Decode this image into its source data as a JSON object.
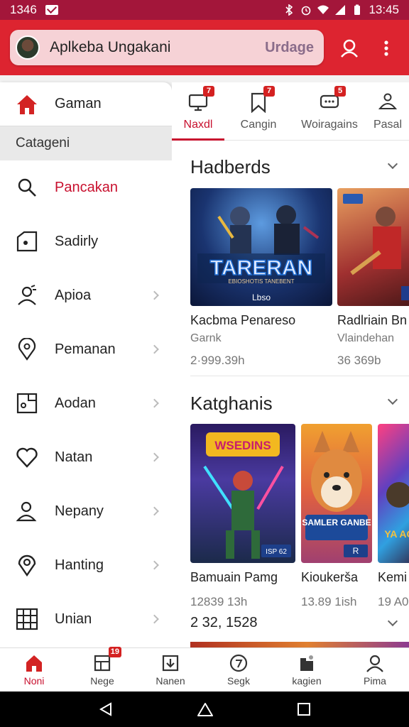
{
  "status": {
    "time_left": "1346",
    "time_right": "13:45"
  },
  "header": {
    "app_name": "Aplkeba Ungakani",
    "upgrade_label": "Urdage"
  },
  "drawer": {
    "top_item": "Gaman",
    "section_label": "Catageni",
    "items": [
      {
        "label": "Pancakan",
        "icon": "search-icon"
      },
      {
        "label": "Sadirly",
        "icon": "folder-icon"
      },
      {
        "label": "Apioa",
        "icon": "puzzle-icon"
      },
      {
        "label": "Pemanan",
        "icon": "map-pin-icon"
      },
      {
        "label": "Aodan",
        "icon": "image-icon"
      },
      {
        "label": "Natan",
        "icon": "heart-icon"
      },
      {
        "label": "Nepany",
        "icon": "user-icon"
      },
      {
        "label": "Hanting",
        "icon": "location-icon"
      },
      {
        "label": "Unian",
        "icon": "grid-icon"
      }
    ]
  },
  "tabs": [
    {
      "label": "Naxdl",
      "badge": "7",
      "icon": "monitor-icon"
    },
    {
      "label": "Cangin",
      "badge": "7",
      "icon": "bookmark-icon"
    },
    {
      "label": "Woiragains",
      "badge": "5",
      "icon": "chat-icon"
    },
    {
      "label": "Pasal",
      "badge": "",
      "icon": "people-icon"
    }
  ],
  "section1": {
    "title": "Hadberds",
    "cards": [
      {
        "title": "Kacbma Penareso",
        "subtitle": "Garnk",
        "meta": "2·999.39h",
        "art_title": "TARERAN",
        "art_sub": "EBIOSHOTIS TANEBENT",
        "art_tag": "Lbso"
      },
      {
        "title": "Radlriain Bn",
        "subtitle": "Vlaindehan",
        "meta": "36 369b"
      }
    ]
  },
  "section2": {
    "title": "Katghanis",
    "cards": [
      {
        "title": "Bamuain Pamg",
        "meta": "12839 13h",
        "art_title": "WSEDINS",
        "art_tag": "ISP 62"
      },
      {
        "title": "Kioukerša",
        "meta": "13.89 1ish",
        "art_title": "SAMLER GANBE",
        "art_tag": "R"
      },
      {
        "title": "Kemi",
        "meta": "19 A0",
        "art_title": "YA AC"
      }
    ],
    "footer_count": "2 32, 1528"
  },
  "bottom_nav": [
    {
      "label": "Noni",
      "icon": "home-icon",
      "badge": ""
    },
    {
      "label": "Nege",
      "icon": "news-icon",
      "badge": "19"
    },
    {
      "label": "Nanen",
      "icon": "download-icon",
      "badge": ""
    },
    {
      "label": "Segk",
      "icon": "clock-icon",
      "badge": ""
    },
    {
      "label": "kagien",
      "icon": "library-icon",
      "badge": ""
    },
    {
      "label": "Pima",
      "icon": "profile-icon",
      "badge": ""
    }
  ],
  "colors": {
    "accent": "#dd2430",
    "status_bar": "#a3163a",
    "active_text": "#c8102e"
  }
}
